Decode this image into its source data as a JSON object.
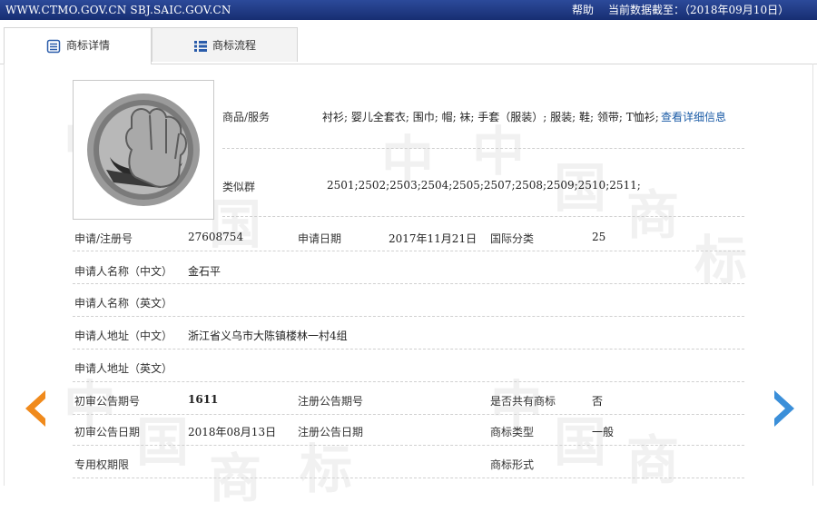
{
  "topbar": {
    "site": "WWW.CTMO.GOV.CN SBJ.SAIC.GOV.CN",
    "help": "帮助",
    "date": "当前数据截至：（2018年09月10日）",
    "bg_color": "#1f3a84"
  },
  "tabs": [
    {
      "label": "商标详情",
      "icon": "document-list-icon"
    },
    {
      "label": "商标流程",
      "icon": "list-icon"
    }
  ],
  "watermark": [
    "中",
    "国",
    "商",
    "标"
  ],
  "goods": {
    "label": "商品/服务",
    "value": "衬衫; 婴儿全套衣; 围巾; 帽; 袜; 手套（服装）; 服装; 鞋; 领带; T恤衫;",
    "link": "查看详细信息"
  },
  "similar": {
    "label": "类似群",
    "value": "2501;2502;2503;2504;2505;2507;2508;2509;2510;2511;"
  },
  "rows": {
    "reg_no_label": "申请/注册号",
    "reg_no": "27608754",
    "apply_date_label": "申请日期",
    "apply_date": "2017年11月21日",
    "intl_class_label": "国际分类",
    "intl_class": "25",
    "applicant_cn_label": "申请人名称（中文）",
    "applicant_cn": "金石平",
    "applicant_en_label": "申请人名称（英文）",
    "address_cn_label": "申请人地址（中文）",
    "address_cn": "浙江省义乌市大陈镇楼林一村4组",
    "address_en_label": "申请人地址（英文）",
    "prelim_no_label": "初审公告期号",
    "prelim_no": "1611",
    "reg_notice_no_label": "注册公告期号",
    "shared_label": "是否共有商标",
    "shared": "否",
    "prelim_date_label": "初审公告日期",
    "prelim_date": "2018年08月13日",
    "reg_date_label": "注册公告日期",
    "type_label": "商标类型",
    "type": "一般",
    "exclusive_label": "专用权期限",
    "form_label": "商标形式"
  },
  "colors": {
    "arrow_left": "#f08a1c",
    "arrow_right": "#3b8fd9",
    "link": "#1a5ba6"
  }
}
